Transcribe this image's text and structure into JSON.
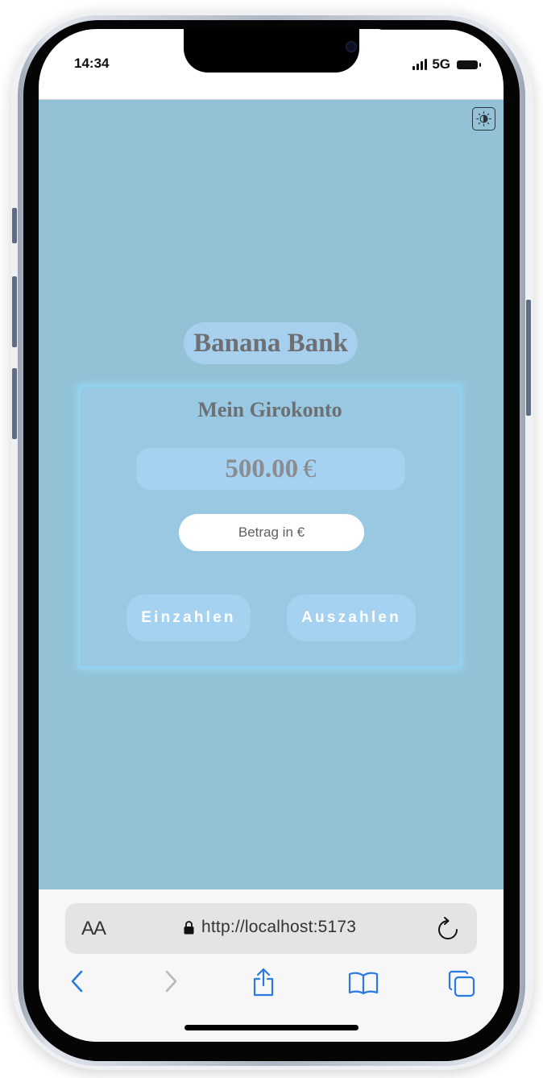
{
  "status_bar": {
    "time": "14:34",
    "network": "5G"
  },
  "app": {
    "theme_toggle_icon": "sun-icon",
    "brand_title": "Banana Bank",
    "account": {
      "title": "Mein Girokonto",
      "balance": "500.00",
      "currency": "€"
    },
    "amount_input": {
      "placeholder": "Betrag in €",
      "value": ""
    },
    "buttons": {
      "deposit": "Einzahlen",
      "withdraw": "Auszahlen"
    },
    "colors": {
      "page_background": "#93c2d6",
      "pill_background": "#a6d2f2",
      "card_glow": "#8fd2f1",
      "heading_text": "#6d6f72"
    }
  },
  "browser": {
    "text_size_label": "AA",
    "url": "http://localhost:5173",
    "toolbar_icons": [
      "back-icon",
      "forward-icon",
      "share-icon",
      "bookmarks-icon",
      "tabs-icon"
    ]
  }
}
